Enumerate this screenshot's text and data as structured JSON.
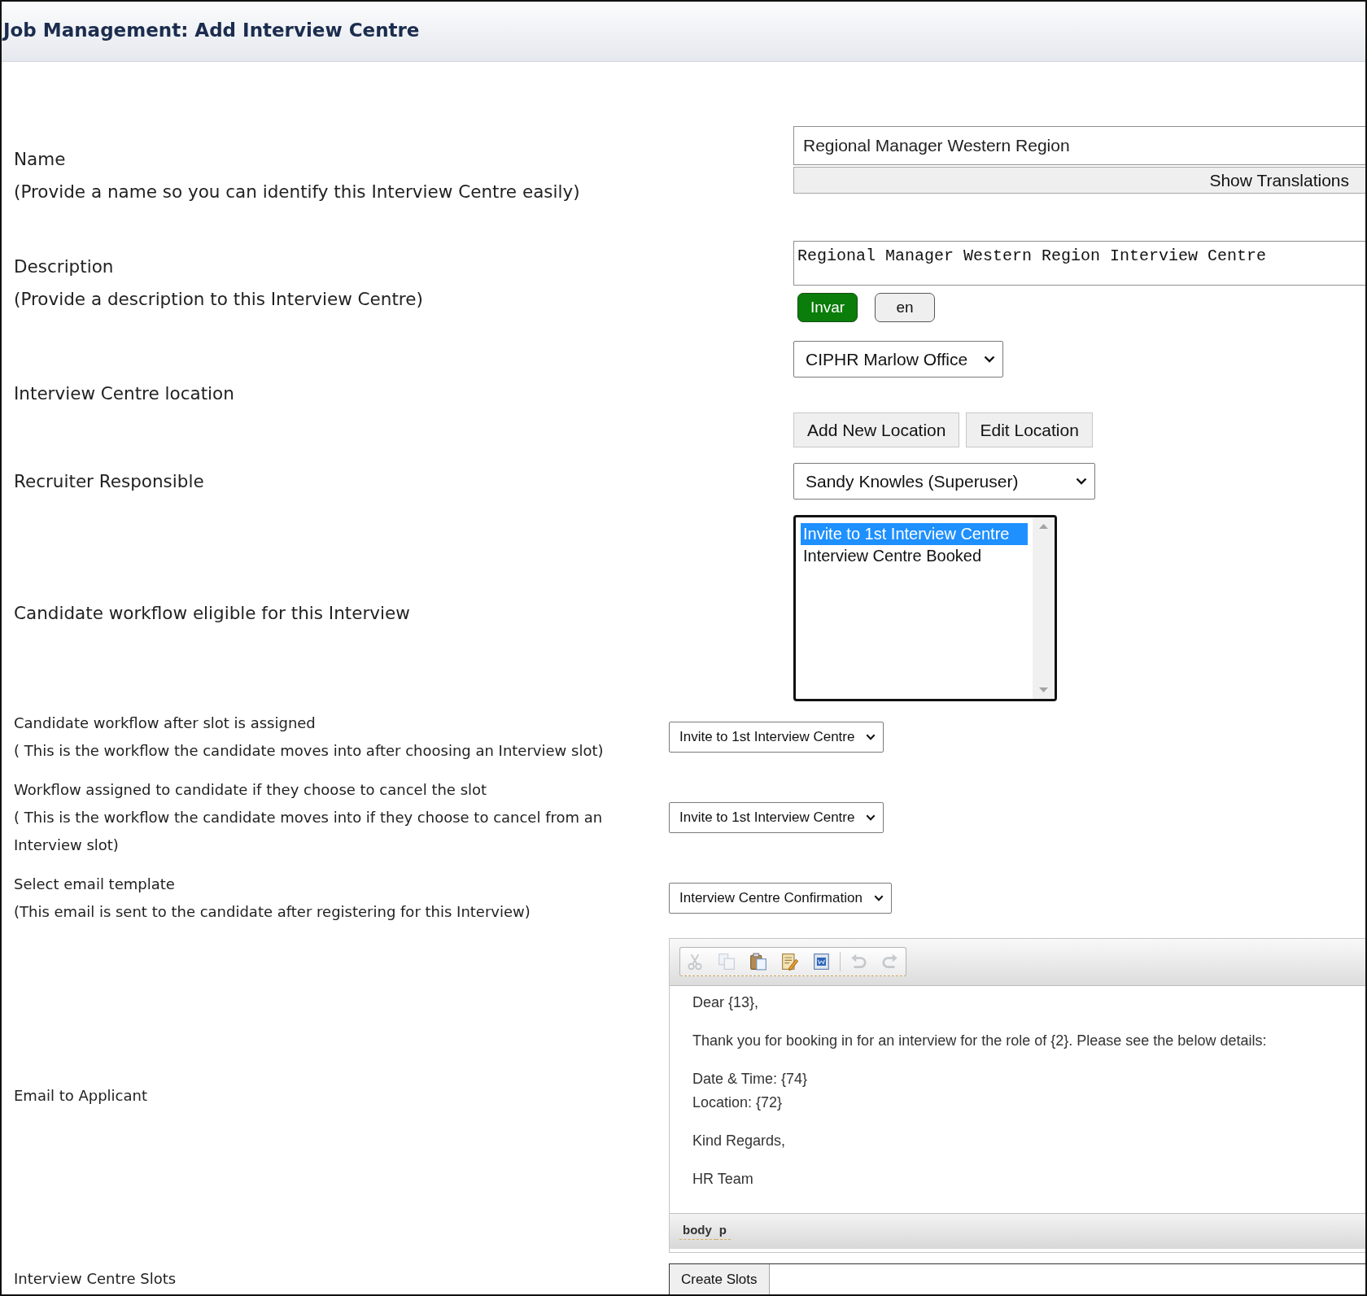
{
  "header": {
    "title": "Job Management: Add Interview Centre"
  },
  "name_field": {
    "label": "Name",
    "hint": "(Provide a name so you can identify this Interview Centre easily)",
    "value": "Regional Manager Western Region",
    "translations_button": "Show Translations"
  },
  "description_field": {
    "label": "Description",
    "hint": "(Provide a description to this Interview Centre)",
    "value": "Regional Manager Western Region Interview Centre",
    "language_buttons": [
      {
        "label": "Invar",
        "selected": true
      },
      {
        "label": "en",
        "selected": false
      }
    ]
  },
  "location_field": {
    "label": "Interview Centre location",
    "value": "CIPHR Marlow Office",
    "buttons": [
      "Add New Location",
      "Edit Location"
    ]
  },
  "recruiter_field": {
    "label": "Recruiter Responsible",
    "value": "Sandy Knowles (Superuser)"
  },
  "eligible_workflow_field": {
    "label": "Candidate workflow eligible for this Interview",
    "options": [
      {
        "label": "Invite to 1st Interview Centre",
        "selected": true
      },
      {
        "label": "Interview Centre Booked",
        "selected": false
      }
    ]
  },
  "workflow_fields": [
    {
      "label": "Candidate workflow after slot is assigned",
      "hint": "( This is the workflow the candidate moves into after choosing an Interview slot)",
      "value": "Invite to 1st Interview Centre"
    },
    {
      "label": "Workflow assigned to candidate if they choose to cancel the slot",
      "hint": "( This is the workflow the candidate moves into if they choose to cancel from an Interview slot)",
      "value": "Invite to 1st Interview Centre"
    },
    {
      "label": "Select email template",
      "hint": "(This email is sent to the candidate after registering for this Interview)",
      "value": "Interview Centre Confirmation"
    }
  ],
  "email_editor": {
    "label": "Email to Applicant",
    "toolbar_groups": [
      [
        {
          "kind": "cut",
          "disabled": true
        },
        {
          "kind": "copy",
          "disabled": true
        },
        {
          "kind": "paste",
          "disabled": false
        },
        {
          "kind": "paste_text",
          "disabled": false
        },
        {
          "kind": "paste_word",
          "disabled": false
        }
      ],
      [
        {
          "kind": "undo",
          "disabled": true
        },
        {
          "kind": "redo",
          "disabled": true
        }
      ]
    ],
    "paragraphs": [
      [
        "Dear {13},"
      ],
      [
        "Thank you for booking in for an interview for the role of {2}. Please see the below details:"
      ],
      [
        "Date & Time: {74}",
        "Location: {72}"
      ],
      [
        "Kind Regards,"
      ],
      [
        "HR Team"
      ]
    ],
    "element_path": [
      "body",
      "p"
    ]
  },
  "slots": {
    "label": "Interview Centre Slots",
    "button": "Create Slots"
  }
}
